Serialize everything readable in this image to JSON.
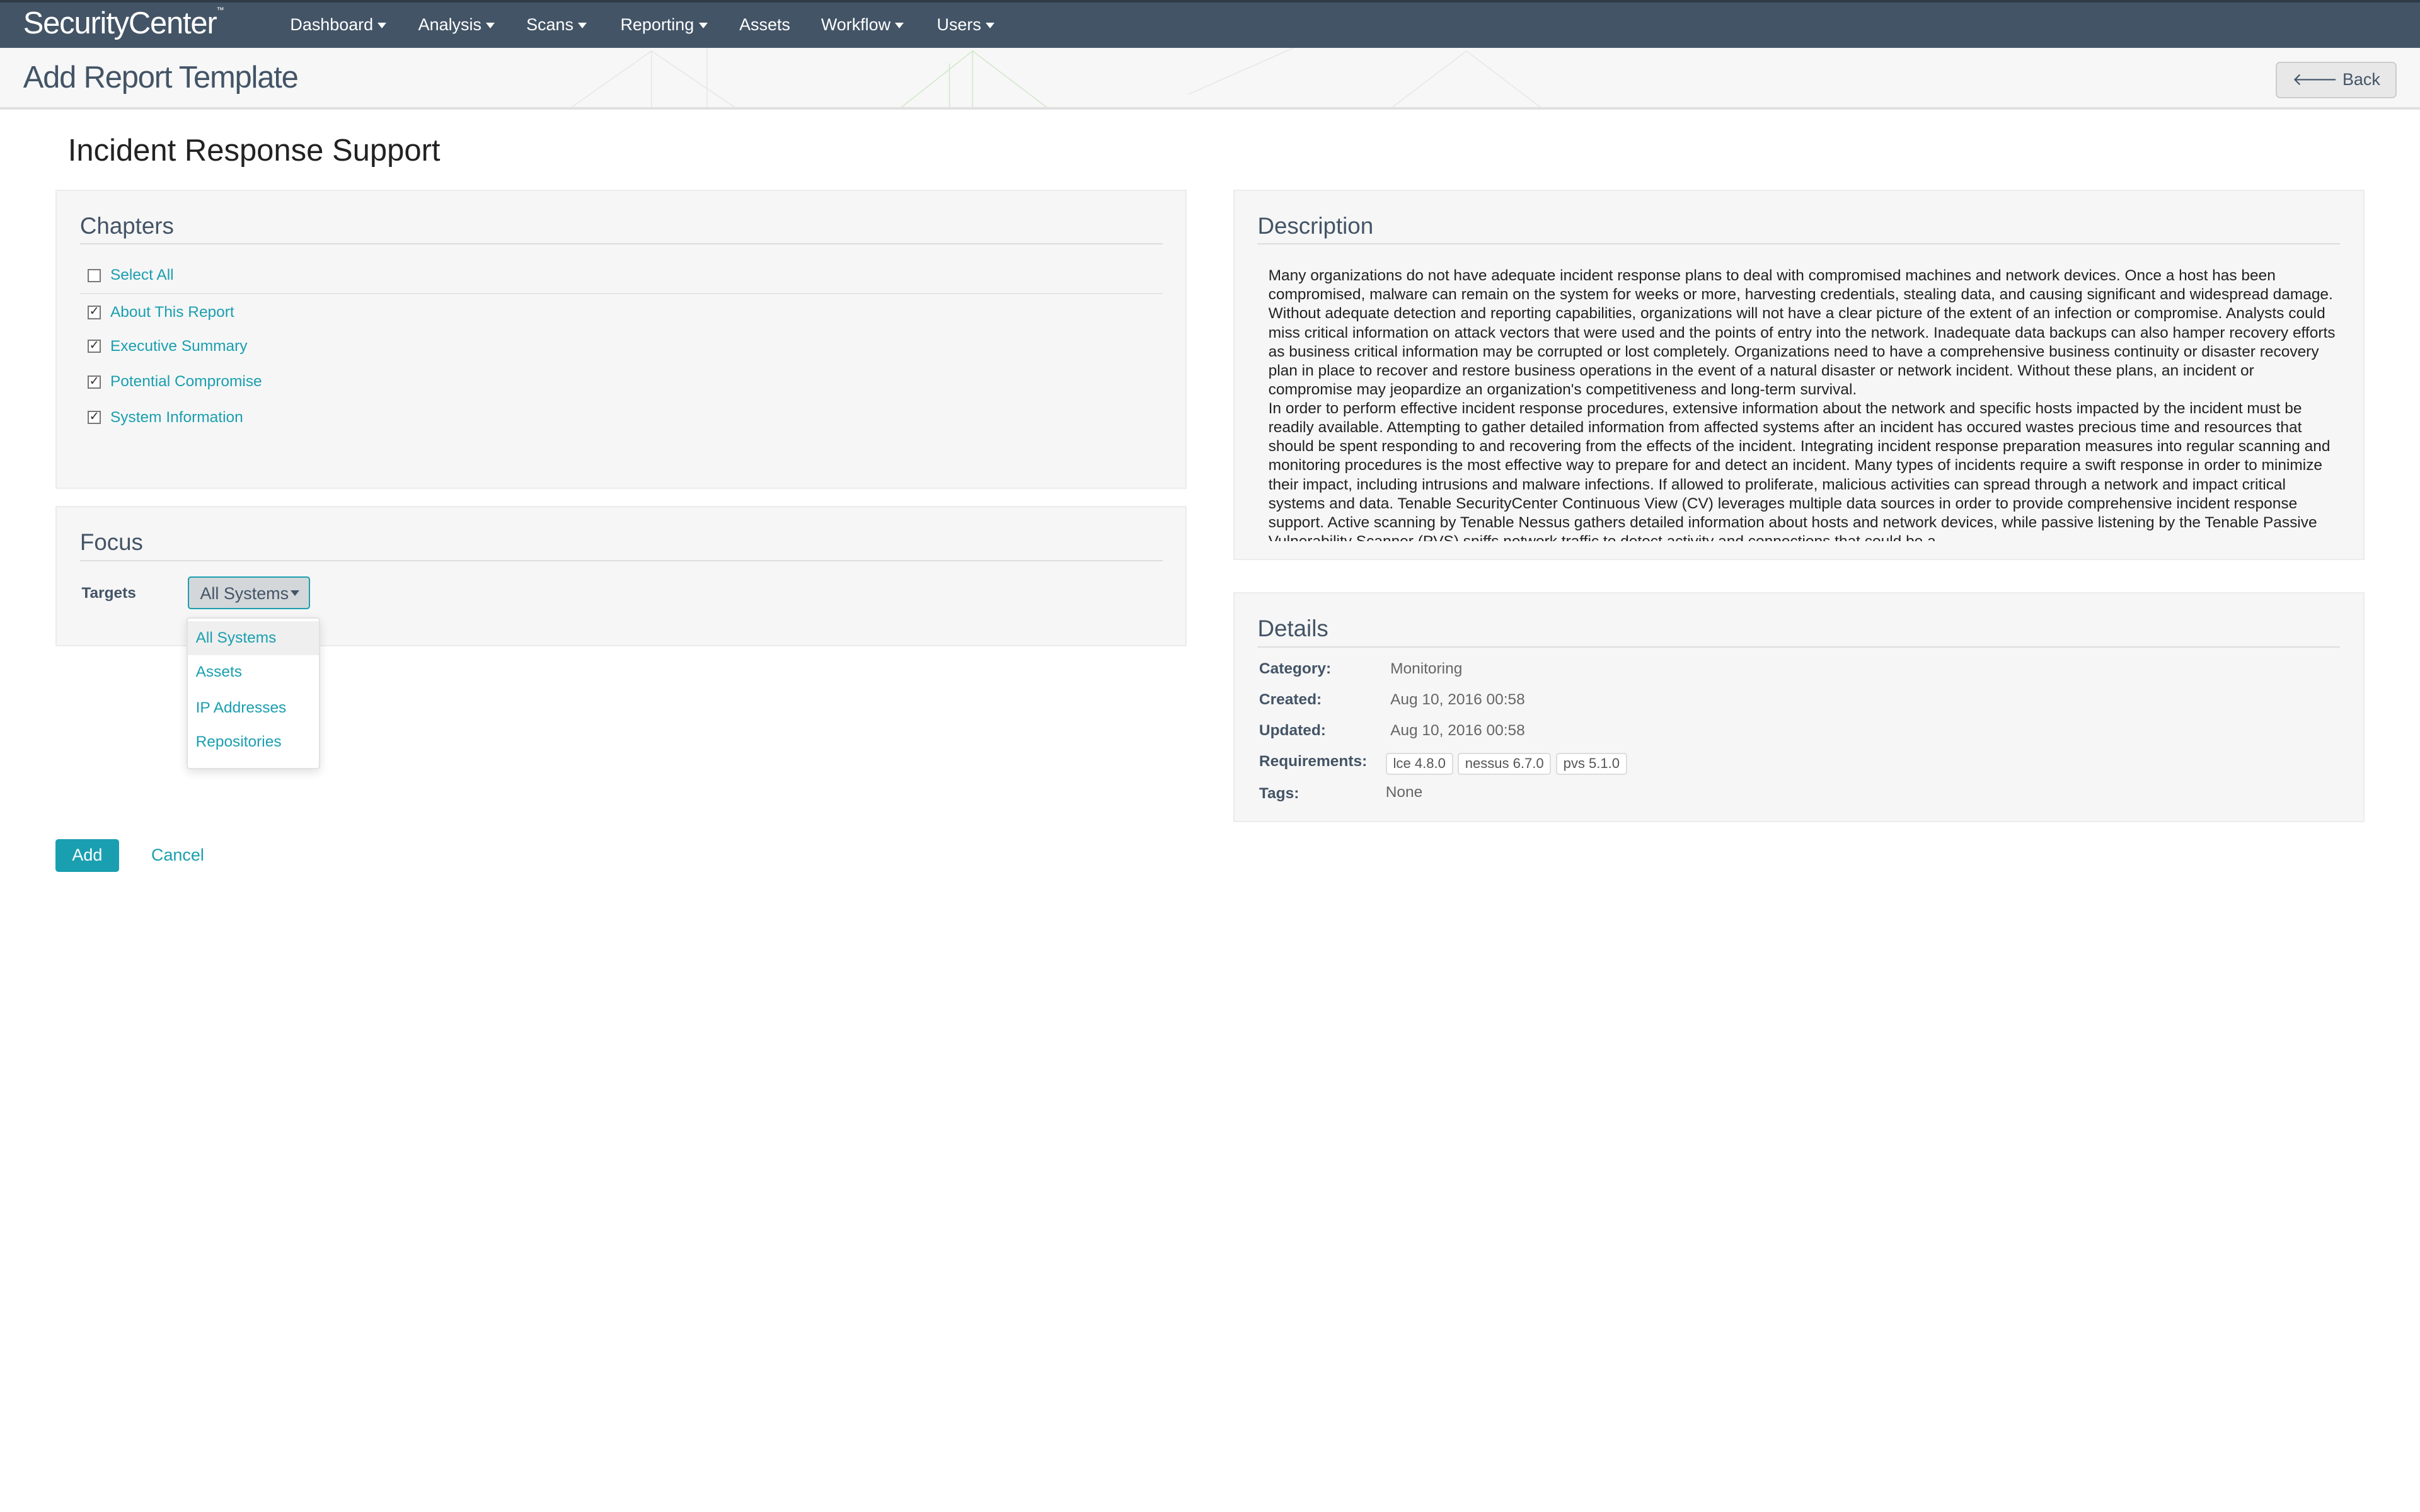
{
  "app": {
    "logo": "SecurityCenter",
    "logo_tm": "™"
  },
  "nav": [
    {
      "label": "Dashboard",
      "dropdown": true
    },
    {
      "label": "Analysis",
      "dropdown": true
    },
    {
      "label": "Scans",
      "dropdown": true
    },
    {
      "label": "Reporting",
      "dropdown": true
    },
    {
      "label": "Assets",
      "dropdown": false
    },
    {
      "label": "Workflow",
      "dropdown": true
    },
    {
      "label": "Users",
      "dropdown": true
    }
  ],
  "header": {
    "title": "Add Report Template",
    "back_label": "Back",
    "back_icon": "arrow-left-icon"
  },
  "template_title": "Incident Response Support",
  "chapters": {
    "heading": "Chapters",
    "select_all": {
      "label": "Select All",
      "checked": false
    },
    "items": [
      {
        "label": "About This Report",
        "checked": true
      },
      {
        "label": "Executive Summary",
        "checked": true
      },
      {
        "label": "Potential Compromise",
        "checked": true
      },
      {
        "label": "System Information",
        "checked": true
      }
    ]
  },
  "focus": {
    "heading": "Focus",
    "targets_label": "Targets",
    "targets_value": "All Systems",
    "options": [
      "All Systems",
      "Assets",
      "IP Addresses",
      "Repositories"
    ]
  },
  "description": {
    "heading": "Description",
    "paragraphs": [
      "Many organizations do not have adequate incident response plans to deal with compromised machines and network devices. Once a host has been compromised, malware can remain on the system for weeks or more, harvesting credentials, stealing data, and causing significant and widespread damage. Without adequate detection and reporting capabilities, organizations will not have a clear picture of the extent of an infection or compromise. Analysts could miss critical information on attack vectors that were used and the points of entry into the network. Inadequate data backups can also hamper recovery efforts as business critical information may be corrupted or lost completely. Organizations need to have a comprehensive business continuity or disaster recovery plan in place to recover and restore business operations in the event of a natural disaster or network incident. Without these plans, an incident or compromise may jeopardize an organization's competitiveness and long-term survival.",
      "In order to perform effective incident response procedures, extensive information about the network and specific hosts impacted by the incident must be readily available. Attempting to gather detailed information from affected systems after an incident has occured wastes precious time and resources that should be spent responding to and recovering from the effects of the incident. Integrating incident response preparation measures into regular scanning and monitoring procedures is the most effective way to prepare for and detect an incident. Many types of incidents require a swift response in order to minimize their impact, including intrusions and malware infections. If allowed to proliferate, malicious activities can spread through a network and impact critical systems and data. Tenable SecurityCenter Continuous View (CV) leverages multiple data sources in order to provide comprehensive incident response support. Active scanning by Tenable Nessus gathers detailed information about hosts and network devices, while passive listening by the Tenable Passive Vulnerability Scanner (PVS) sniffs network traffic to detect activity and connections that could be a"
    ]
  },
  "details": {
    "heading": "Details",
    "category_label": "Category:",
    "category": "Monitoring",
    "created_label": "Created:",
    "created": "Aug 10, 2016 00:58",
    "updated_label": "Updated:",
    "updated": "Aug 10, 2016 00:58",
    "requirements_label": "Requirements:",
    "requirements": [
      "lce 4.8.0",
      "nessus 6.7.0",
      "pvs 5.1.0"
    ],
    "tags_label": "Tags:",
    "tags": "None"
  },
  "actions": {
    "add_label": "Add",
    "cancel_label": "Cancel"
  },
  "colors": {
    "navbar": "#435466",
    "accent": "#1a9fb0"
  }
}
